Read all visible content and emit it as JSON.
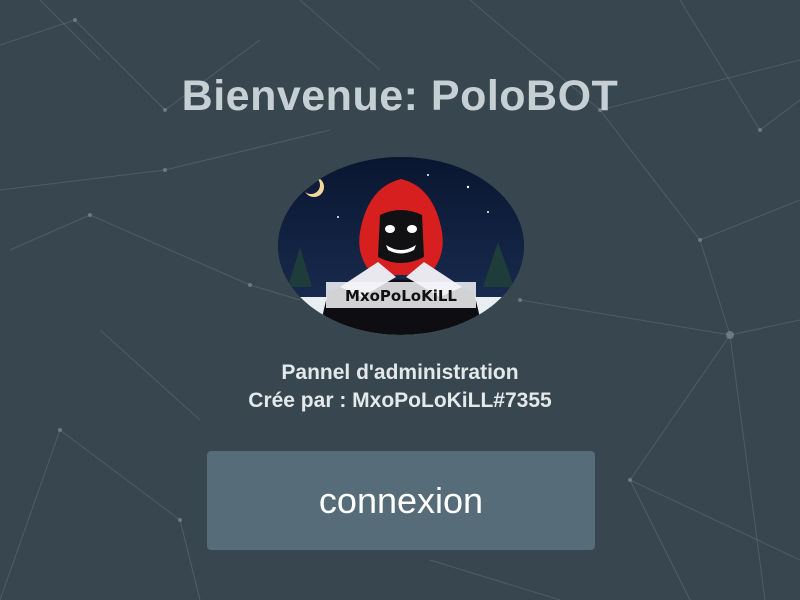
{
  "header": {
    "title": "Bienvenue: PoloBOT"
  },
  "avatar": {
    "alt_text": "MxoPoLoKiLL",
    "icon": "hooded-figure-avatar"
  },
  "info": {
    "line1": "Pannel d'administration",
    "line2": "Crée par : MxoPoLoKiLL#7355"
  },
  "login": {
    "button_label": "connexion"
  },
  "colors": {
    "background": "#38474f",
    "button": "#566c78",
    "title": "#c6d0d4",
    "hood_red": "#e02020"
  }
}
